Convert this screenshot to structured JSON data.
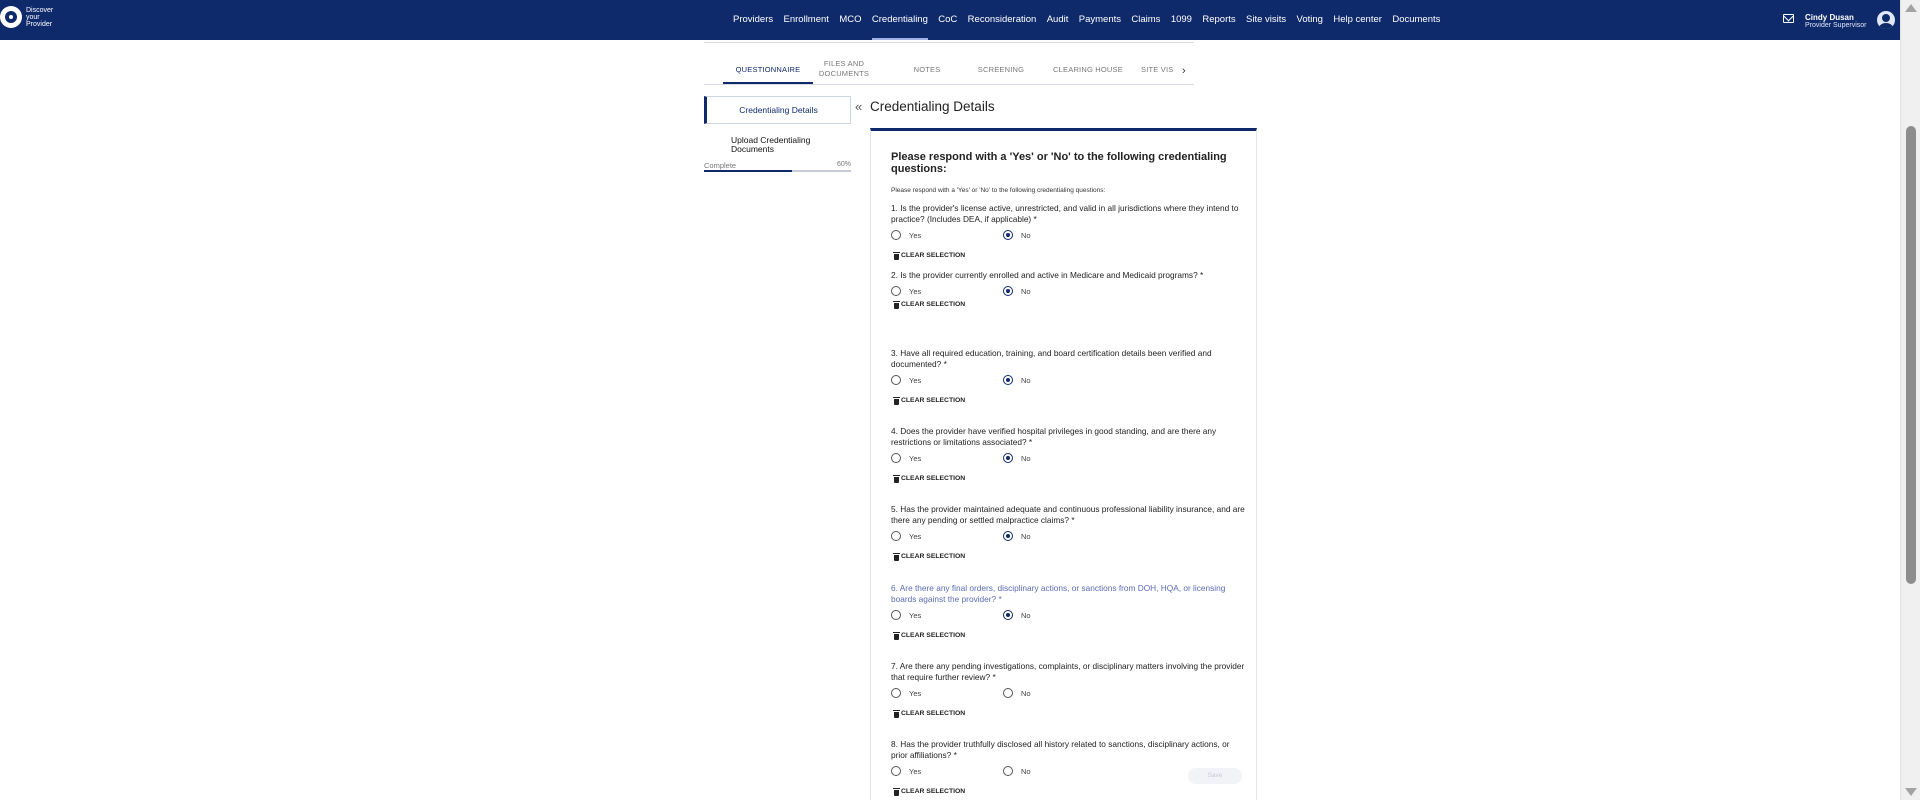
{
  "brand": {
    "line1": "Discover",
    "line2": "your",
    "line3": "Provider"
  },
  "nav": [
    {
      "label": "Providers"
    },
    {
      "label": "Enrollment"
    },
    {
      "label": "MCO"
    },
    {
      "label": "Credentialing",
      "active": true
    },
    {
      "label": "CoC"
    },
    {
      "label": "Reconsideration"
    },
    {
      "label": "Audit"
    },
    {
      "label": "Payments"
    },
    {
      "label": "Claims"
    },
    {
      "label": "1099"
    },
    {
      "label": "Reports"
    },
    {
      "label": "Site visits"
    },
    {
      "label": "Voting"
    },
    {
      "label": "Help center"
    },
    {
      "label": "Documents"
    }
  ],
  "user": {
    "name": "Cindy Dusan",
    "role": "Provider Supervisor"
  },
  "tabs": [
    {
      "label": "QUESTIONNAIRE",
      "active": true
    },
    {
      "label": "FILES AND DOCUMENTS"
    },
    {
      "label": "NOTES"
    },
    {
      "label": "SCREENING"
    },
    {
      "label": "CLEARING HOUSE"
    },
    {
      "label": "SITE VIS"
    }
  ],
  "sidebar": {
    "active_item": "Credentialing Details",
    "item2": "Upload Credentialing Documents",
    "progress_label": "Complete",
    "progress_pct": "60%",
    "progress_value": 0.6
  },
  "main": {
    "title": "Credentialing Details",
    "heading": "Please respond with a 'Yes' or 'No' to the following credentialing questions:",
    "subheading": "Please respond with a 'Yes' or 'No' to the following credentialing questions:",
    "yes_label": "Yes",
    "no_label": "No",
    "clear_label": "CLEAR SELECTION",
    "save_label": "Save"
  },
  "questions": [
    {
      "text": "1. Is the provider's license active, unrestricted, and valid in all jurisdictions where they intend to practice? (Includes DEA, if applicable) *",
      "answer": "No"
    },
    {
      "text": "2. Is the provider currently enrolled and active in Medicare and Medicaid programs? *",
      "answer": "No"
    },
    {
      "text": "3. Have all required education, training, and board certification details been verified and documented? *",
      "answer": "No"
    },
    {
      "text": "4. Does the provider have verified hospital privileges in good standing, and are there any restrictions or limitations associated? *",
      "answer": "No"
    },
    {
      "text": "5. Has the provider maintained adequate and continuous professional liability insurance, and are there any pending or settled malpractice claims? *",
      "answer": "No"
    },
    {
      "text": "6. Are there any final orders, disciplinary actions, or sanctions from DOH, HQA, or licensing boards against the provider? *",
      "answer": "No",
      "highlight": true
    },
    {
      "text": "7. Are there any pending investigations, complaints, or disciplinary matters involving the provider that require further review? *",
      "answer": ""
    },
    {
      "text": "8. Has the provider truthfully disclosed all history related to sanctions, disciplinary actions, or prior affiliations? *",
      "answer": ""
    }
  ]
}
